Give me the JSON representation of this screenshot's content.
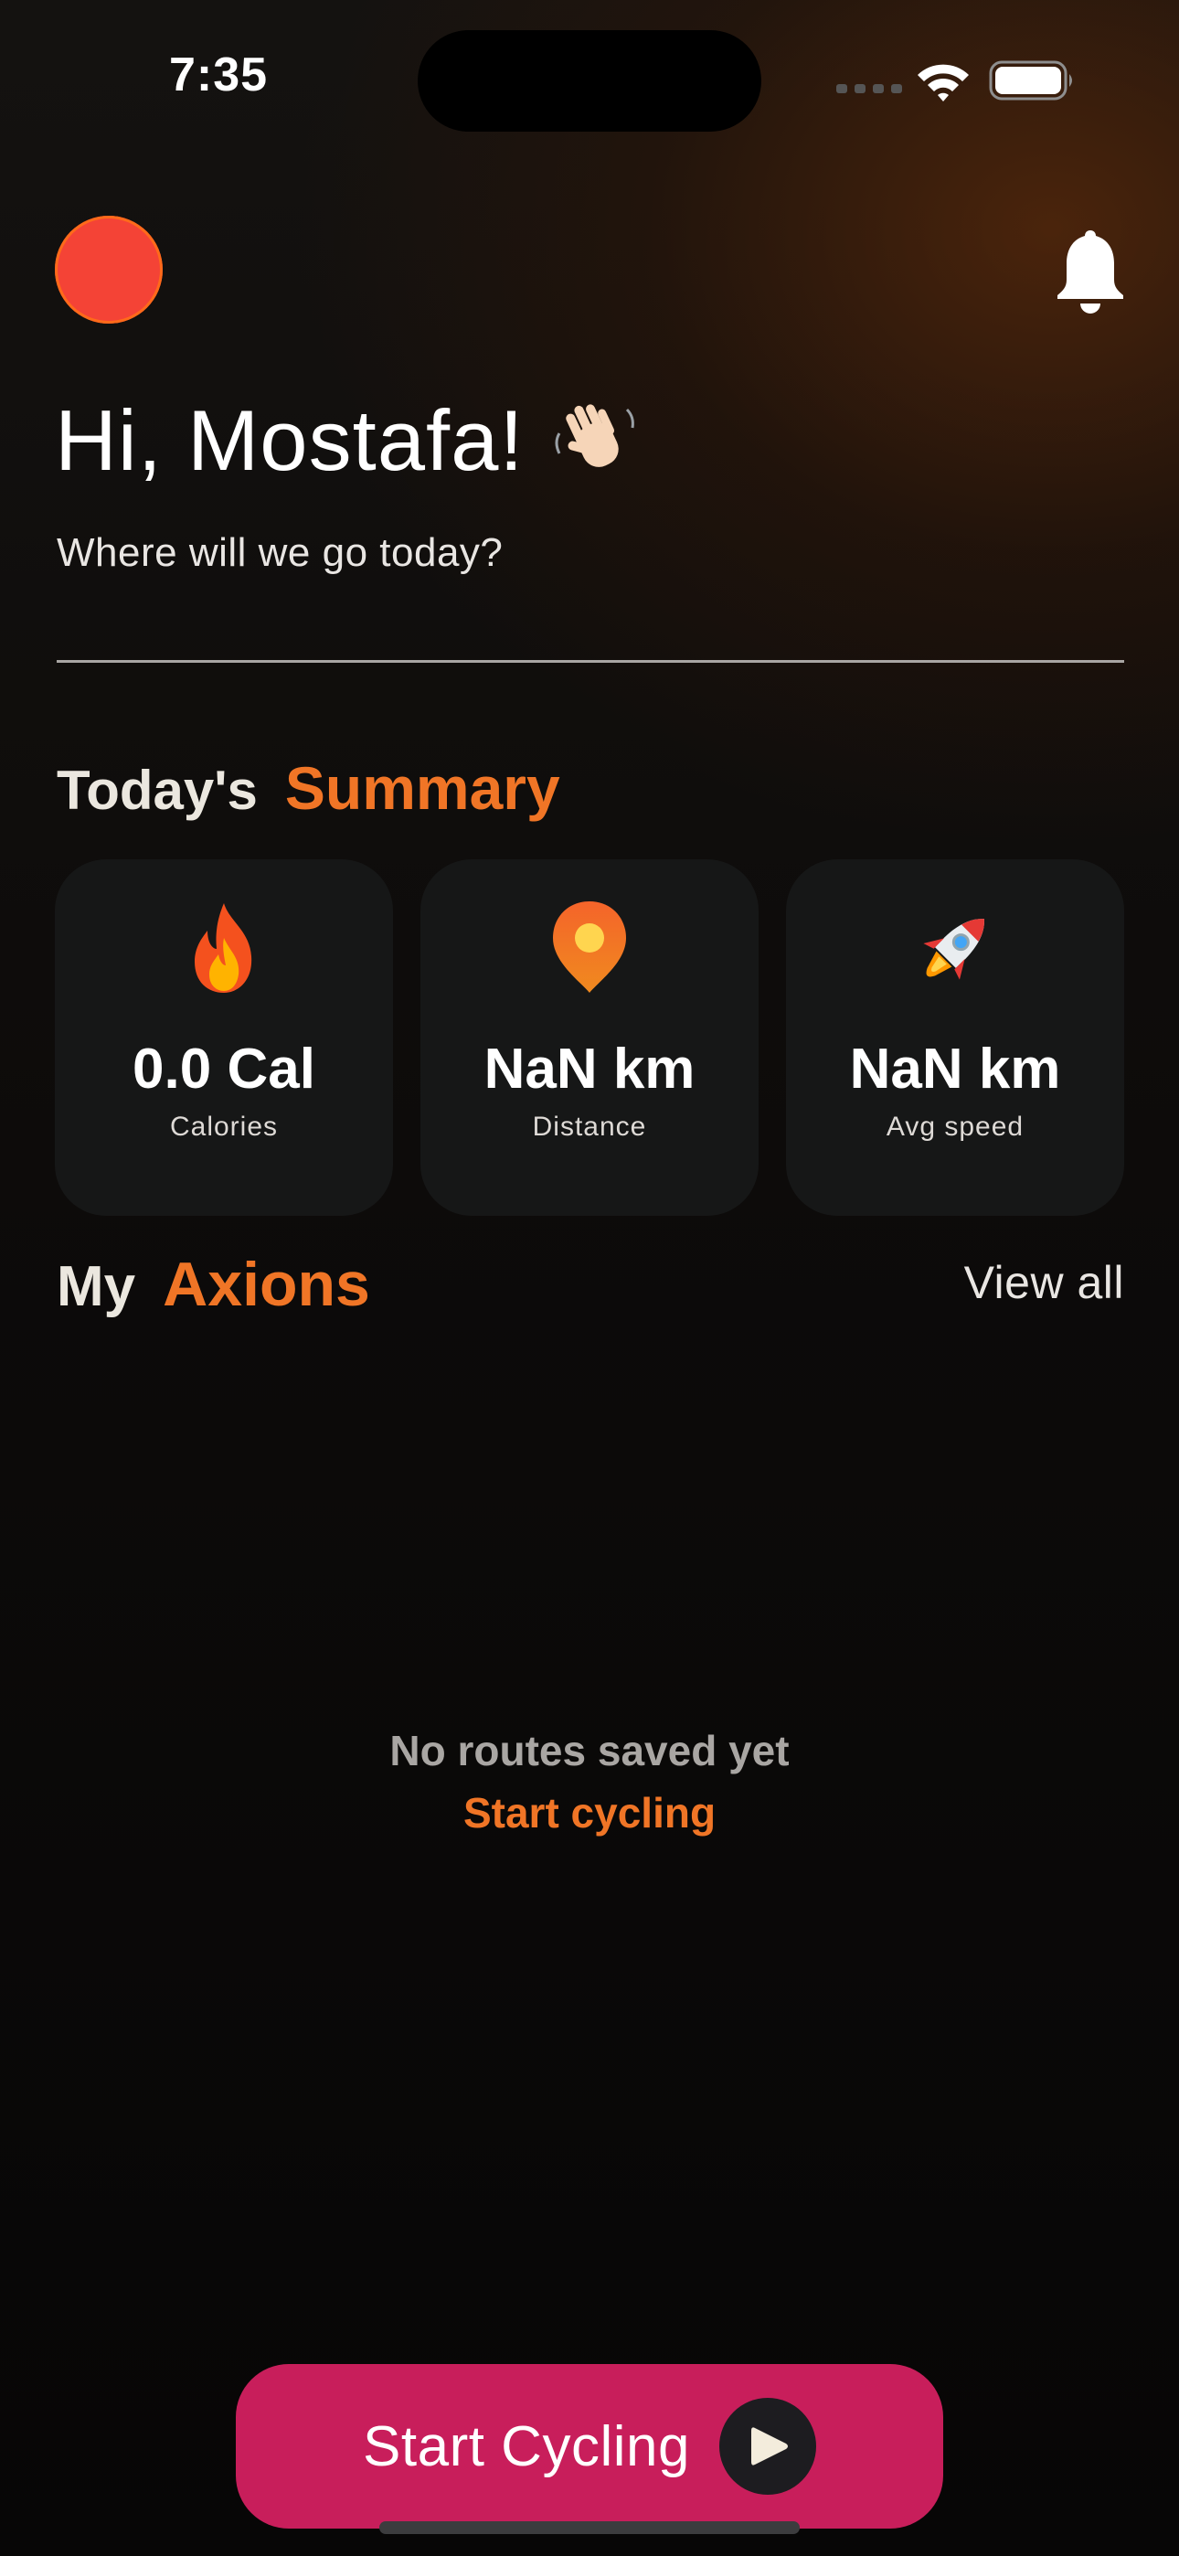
{
  "status_bar": {
    "time": "7:35"
  },
  "header": {
    "greeting": "Hi, Mostafa!",
    "subtitle": "Where will we go today?",
    "avatar_color": "#f44336",
    "icons": [
      "bell-icon",
      "waving-hand-icon"
    ]
  },
  "summary": {
    "title_plain": "Today's",
    "title_accent": "Summary",
    "cards": [
      {
        "icon": "fire-icon",
        "value": "0.0 Cal",
        "label": "Calories"
      },
      {
        "icon": "location-pin-icon",
        "value": "NaN km",
        "label": "Distance"
      },
      {
        "icon": "rocket-icon",
        "value": "NaN km",
        "label": "Avg speed"
      }
    ]
  },
  "axions": {
    "title_plain": "My",
    "title_accent": "Axions",
    "view_all": "View all",
    "empty_message": "No routes saved yet",
    "empty_action": "Start cycling"
  },
  "cta": {
    "label": "Start Cycling",
    "icon": "play-icon"
  },
  "theme": {
    "accent": "#f07526",
    "cta_color": "#c81e5b",
    "card_bg": "#161717"
  }
}
